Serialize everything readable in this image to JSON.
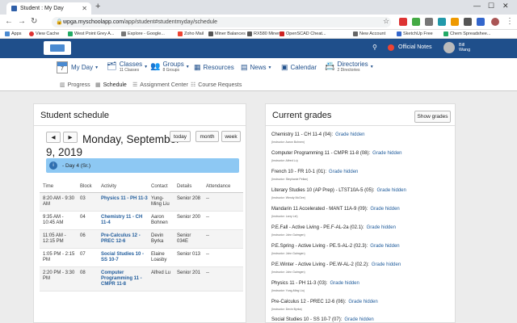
{
  "browser": {
    "tab_title": "Student : My Day",
    "url_host": "wpga.myschoolapp.com",
    "url_path": "/app/student#studentmyday/schedule",
    "bookmarks": [
      "Apps",
      "View Cache",
      "West Point Grey A...",
      "Explore - Google...",
      "Zoho Mail",
      "Miner Balances",
      "RX580 Miner",
      "OpenSCAD Cheat...",
      "New Account",
      "SketchUp Free",
      "Chem Spreadshee..."
    ]
  },
  "header": {
    "notes_label": "Official Notes",
    "user_first": "Bill",
    "user_last": "Wang"
  },
  "menu": {
    "myday": {
      "cal_num": "7",
      "label": "My Day"
    },
    "classes": {
      "label": "Classes",
      "sub": "11 Classes"
    },
    "groups": {
      "label": "Groups",
      "sub": "8 Groups"
    },
    "resources": {
      "label": "Resources"
    },
    "news": {
      "label": "News"
    },
    "calendar": {
      "label": "Calendar"
    },
    "directories": {
      "label": "Directories",
      "sub": "2 Directories"
    }
  },
  "subnav": {
    "progress": "Progress",
    "schedule": "Schedule",
    "assignment": "Assignment Center",
    "requests": "Course Requests"
  },
  "schedule": {
    "title": "Student schedule",
    "prev": "◀",
    "next": "▶",
    "today": "today",
    "month": "month",
    "week": "week",
    "date_line1": "Monday, September",
    "date_line2": "9, 2019",
    "day_banner": "- Day 4 (Sr.)",
    "columns": [
      "Time",
      "Block",
      "Activity",
      "Contact",
      "Details",
      "Attendance"
    ],
    "rows": [
      {
        "time": "8:20 AM - 9:30 AM",
        "block": "03",
        "activity": "Physics 11 - PH 11-3",
        "contact": "Yung-Ming Liu",
        "details": "Senior 208",
        "attendance": "--"
      },
      {
        "time": "9:35 AM - 10:45 AM",
        "block": "04",
        "activity": "Chemistry 11 - CH 11-4",
        "contact": "Aaron Bohnen",
        "details": "Senior 200",
        "attendance": "--"
      },
      {
        "time": "11:05 AM - 12:15 PM",
        "block": "06",
        "activity": "Pre-Calculus 12 - PREC 12-6",
        "contact": "Devin Byrka",
        "details": "Senior 034E",
        "attendance": "--"
      },
      {
        "time": "1:05 PM - 2:15 PM",
        "block": "07",
        "activity": "Social Studies 10 - SS 10-7",
        "contact": "Elaine Loasby",
        "details": "Senior 013",
        "attendance": "--"
      },
      {
        "time": "2:20 PM - 3:30 PM",
        "block": "08",
        "activity": "Computer Programming 11 - CMPR 11-8",
        "contact": "Alfred Lu",
        "details": "Senior 201",
        "attendance": "--"
      }
    ]
  },
  "grades": {
    "title": "Current grades",
    "show_btn": "Show grades",
    "items": [
      {
        "course": "Chemistry 11 - CH 11-4 (04):",
        "status": "Grade hidden",
        "instructor": "(Instructor: Aaron Bohnen)"
      },
      {
        "course": "Computer Programming 11 - CMPR 11-8 (08):",
        "status": "Grade hidden",
        "instructor": "(Instructor: Alfred Lu)"
      },
      {
        "course": "French 10 - FR 10-1 (01):",
        "status": "Grade hidden",
        "instructor": "(Instructor: Stephanie Pellan)"
      },
      {
        "course": "Literary Studies 10 (AP Prep) - LTST10A-5 (05):",
        "status": "Grade hidden",
        "instructor": "(Instructor: Wendy McGee)"
      },
      {
        "course": "Mandarin 11 Accelerated - MANT 11A-9 (09):",
        "status": "Grade hidden",
        "instructor": "(Instructor: Larry Lei)"
      },
      {
        "course": "P.E.Fall - Active Living - PE.F-AL-2a (02.1):",
        "status": "Grade hidden",
        "instructor": "(Instructor: John Gaimgen)"
      },
      {
        "course": "P.E.Spring - Active Living - PE.S-AL-2 (02.3):",
        "status": "Grade hidden",
        "instructor": "(Instructor: John Gaimgen)"
      },
      {
        "course": "P.E.Winter - Active Living - PE.W-AL-2 (02.2):",
        "status": "Grade hidden",
        "instructor": "(Instructor: John Gaimgen)"
      },
      {
        "course": "Physics 11 - PH 11-3 (03):",
        "status": "Grade hidden",
        "instructor": "(Instructor: Yung-Ming Liu)"
      },
      {
        "course": "Pre-Calculus 12 - PREC 12-6 (06):",
        "status": "Grade hidden",
        "instructor": "(Instructor: Devin Byrka)"
      },
      {
        "course": "Social Studies 10 - SS 10-7 (07):",
        "status": "Grade hidden",
        "instructor": ""
      }
    ]
  },
  "colors": {
    "brand": "#1f4f8b",
    "link": "#1f5b9b",
    "banner": "#8dc8f3"
  }
}
